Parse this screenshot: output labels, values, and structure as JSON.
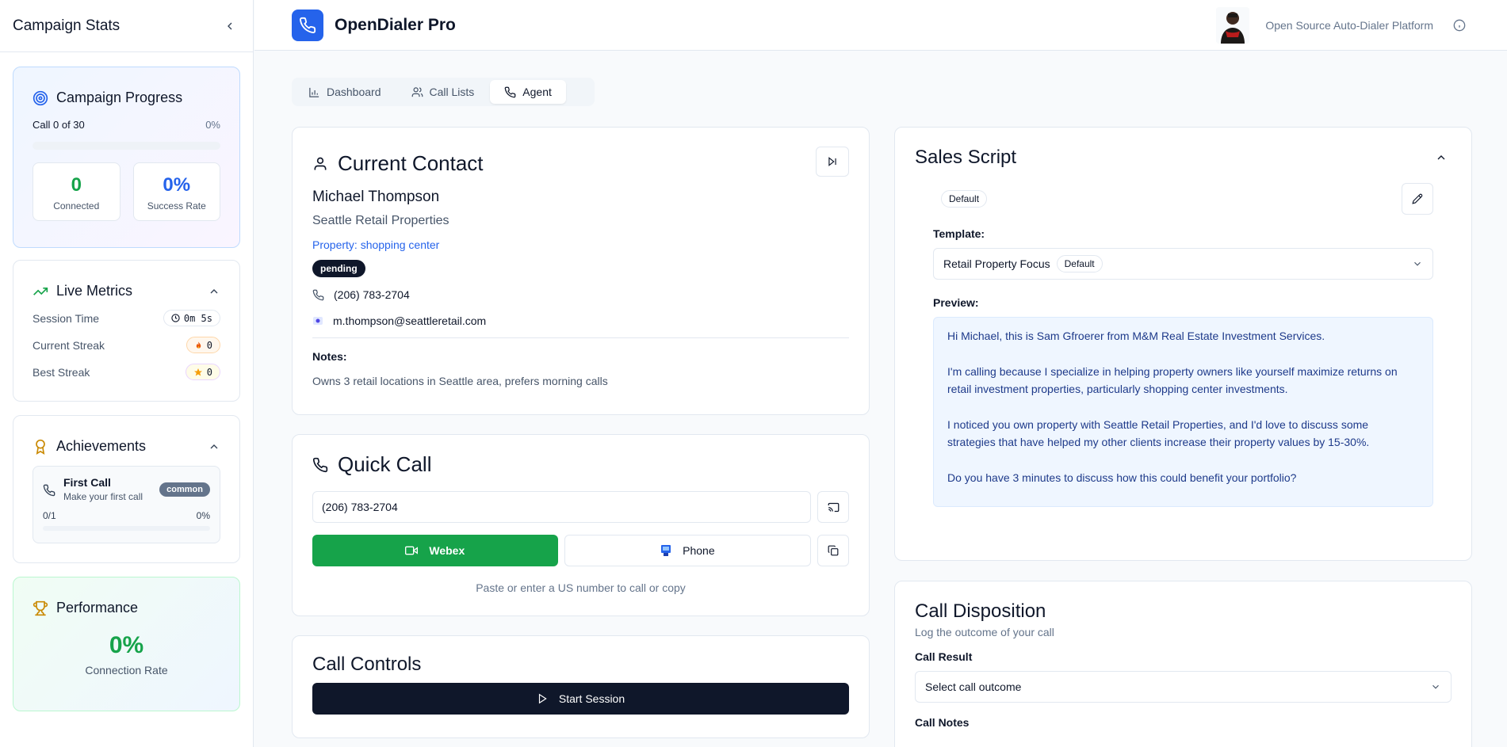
{
  "sidebar": {
    "title": "Campaign Stats",
    "progress": {
      "title": "Campaign Progress",
      "call_label": "Call 0 of 30",
      "percent_label": "0%",
      "progress_fraction": 0,
      "connected_value": "0",
      "connected_label": "Connected",
      "success_value": "0%",
      "success_label": "Success Rate"
    },
    "live_metrics": {
      "title": "Live Metrics",
      "items": [
        {
          "label": "Session Time",
          "value": "0m 5s",
          "icon": "clock-icon"
        },
        {
          "label": "Current Streak",
          "value": "0",
          "icon": "fire-icon"
        },
        {
          "label": "Best Streak",
          "value": "0",
          "icon": "star-icon"
        }
      ]
    },
    "achievements": {
      "title": "Achievements",
      "items": [
        {
          "name": "First Call",
          "description": "Make your first call",
          "rarity": "common",
          "progress": "0/1",
          "percent": "0%",
          "fraction": 0
        }
      ]
    },
    "performance": {
      "title": "Performance",
      "value": "0%",
      "label": "Connection Rate"
    }
  },
  "header": {
    "app_title": "OpenDialer Pro",
    "tagline": "Open Source Auto-Dialer Platform"
  },
  "tabs": [
    {
      "label": "Dashboard",
      "icon": "bar-chart-icon",
      "active": false
    },
    {
      "label": "Call Lists",
      "icon": "users-icon",
      "active": false
    },
    {
      "label": "Agent",
      "icon": "phone-icon",
      "active": true
    }
  ],
  "contact": {
    "title": "Current Contact",
    "name": "Michael Thompson",
    "company": "Seattle Retail Properties",
    "property": "Property: shopping center",
    "status": "pending",
    "phone": "(206) 783-2704",
    "email": "m.thompson@seattleretail.com",
    "notes_label": "Notes:",
    "notes": "Owns 3 retail locations in Seattle area, prefers morning calls"
  },
  "quick_call": {
    "title": "Quick Call",
    "number_value": "(206) 783-2704",
    "webex_label": "Webex",
    "phone_label": "Phone",
    "hint": "Paste or enter a US number to call or copy"
  },
  "call_controls": {
    "title": "Call Controls",
    "start_label": "Start Session"
  },
  "sales_script": {
    "title": "Sales Script",
    "default_badge": "Default",
    "template_label": "Template:",
    "template_value": "Retail Property Focus",
    "template_badge": "Default",
    "preview_label": "Preview:",
    "preview_paragraphs": [
      "Hi Michael, this is Sam Gfroerer from M&M Real Estate Investment Services.",
      "I'm calling because I specialize in helping property owners like yourself maximize returns on retail investment properties, particularly shopping center investments.",
      "I noticed you own property with Seattle Retail Properties, and I'd love to discuss some strategies that have helped my other clients increase their property values by 15-30%.",
      "Do you have 3 minutes to discuss how this could benefit your portfolio?"
    ]
  },
  "call_disposition": {
    "title": "Call Disposition",
    "subtitle": "Log the outcome of your call",
    "result_label": "Call Result",
    "result_placeholder": "Select call outcome",
    "notes_label": "Call Notes"
  },
  "colors": {
    "primary": "#2563eb",
    "success": "#16a34a",
    "dark": "#0f172a"
  }
}
